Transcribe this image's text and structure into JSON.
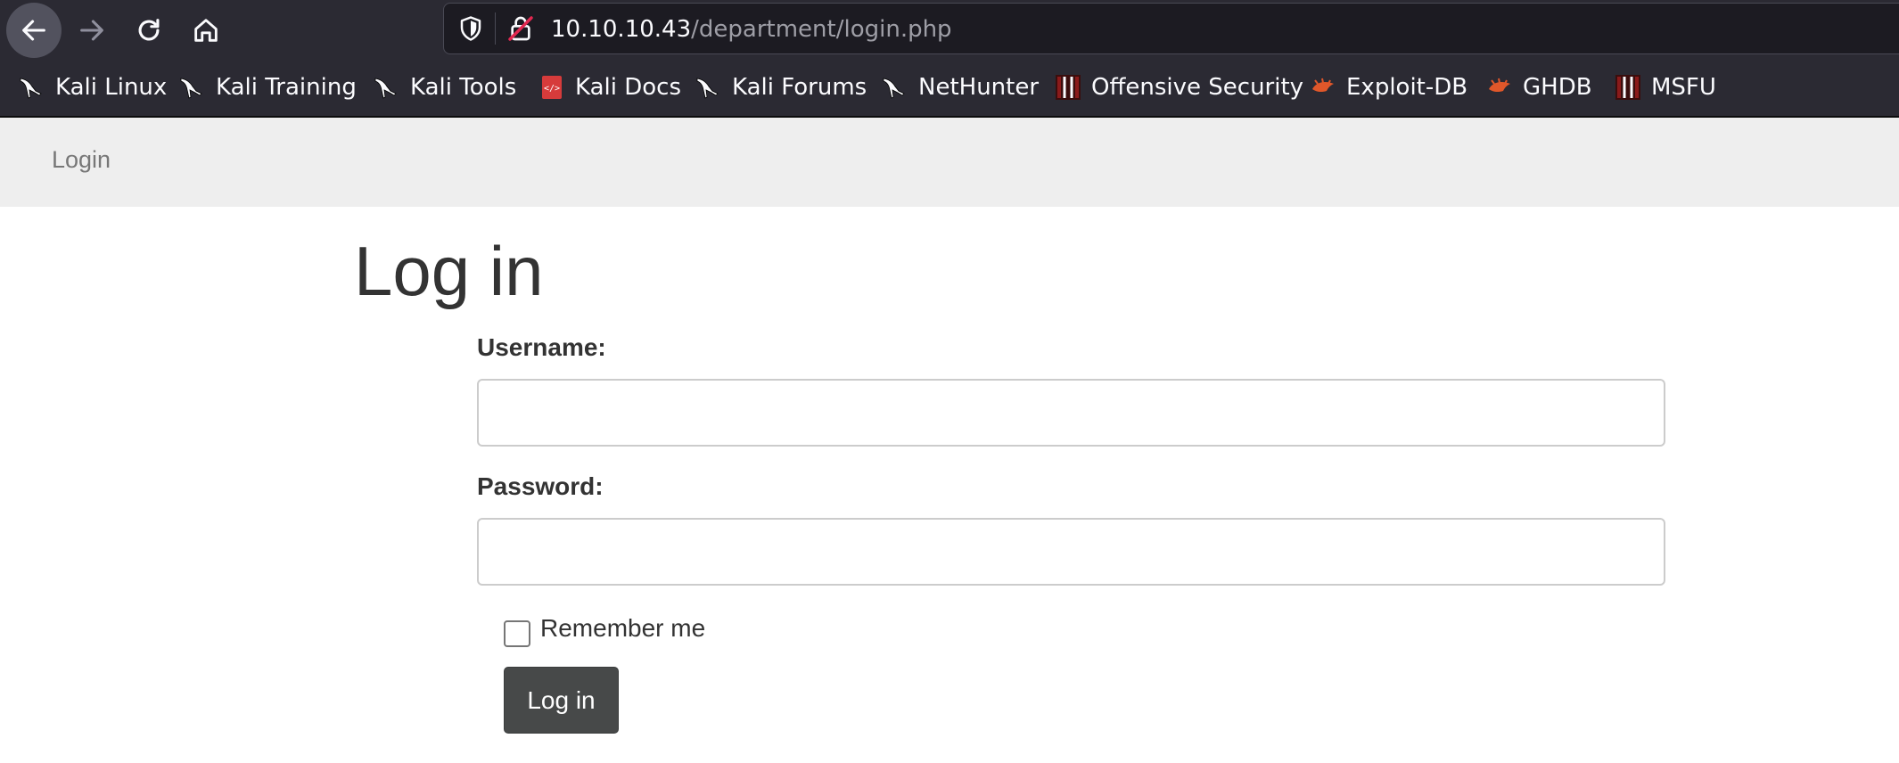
{
  "browser": {
    "url_host": "10.10.10.43",
    "url_path": "/department/login.php",
    "bookmarks": [
      {
        "label": "Kali Linux",
        "icon": "kali-dragon-icon"
      },
      {
        "label": "Kali Training",
        "icon": "kali-dragon-icon"
      },
      {
        "label": "Kali Tools",
        "icon": "kali-dragon-icon"
      },
      {
        "label": "Kali Docs",
        "icon": "kali-docs-icon"
      },
      {
        "label": "Kali Forums",
        "icon": "kali-dragon-icon"
      },
      {
        "label": "NetHunter",
        "icon": "kali-dragon-icon"
      },
      {
        "label": "Offensive Security",
        "icon": "offsec-icon"
      },
      {
        "label": "Exploit-DB",
        "icon": "exploitdb-bug-icon"
      },
      {
        "label": "GHDB",
        "icon": "exploitdb-bug-icon"
      },
      {
        "label": "MSFU",
        "icon": "offsec-icon"
      }
    ]
  },
  "page": {
    "nav_link": "Login",
    "title": "Log in",
    "username_label": "Username:",
    "password_label": "Password:",
    "username_value": "",
    "password_value": "",
    "remember_label": "Remember me",
    "remember_checked": false,
    "submit_label": "Log in"
  },
  "colors": {
    "browser_chrome": "#2b2a33",
    "urlbar_bg": "#1c1b22",
    "navbar_bg": "#eeeeee",
    "button_bg": "#474949",
    "exploitdb_orange": "#e0572a"
  }
}
